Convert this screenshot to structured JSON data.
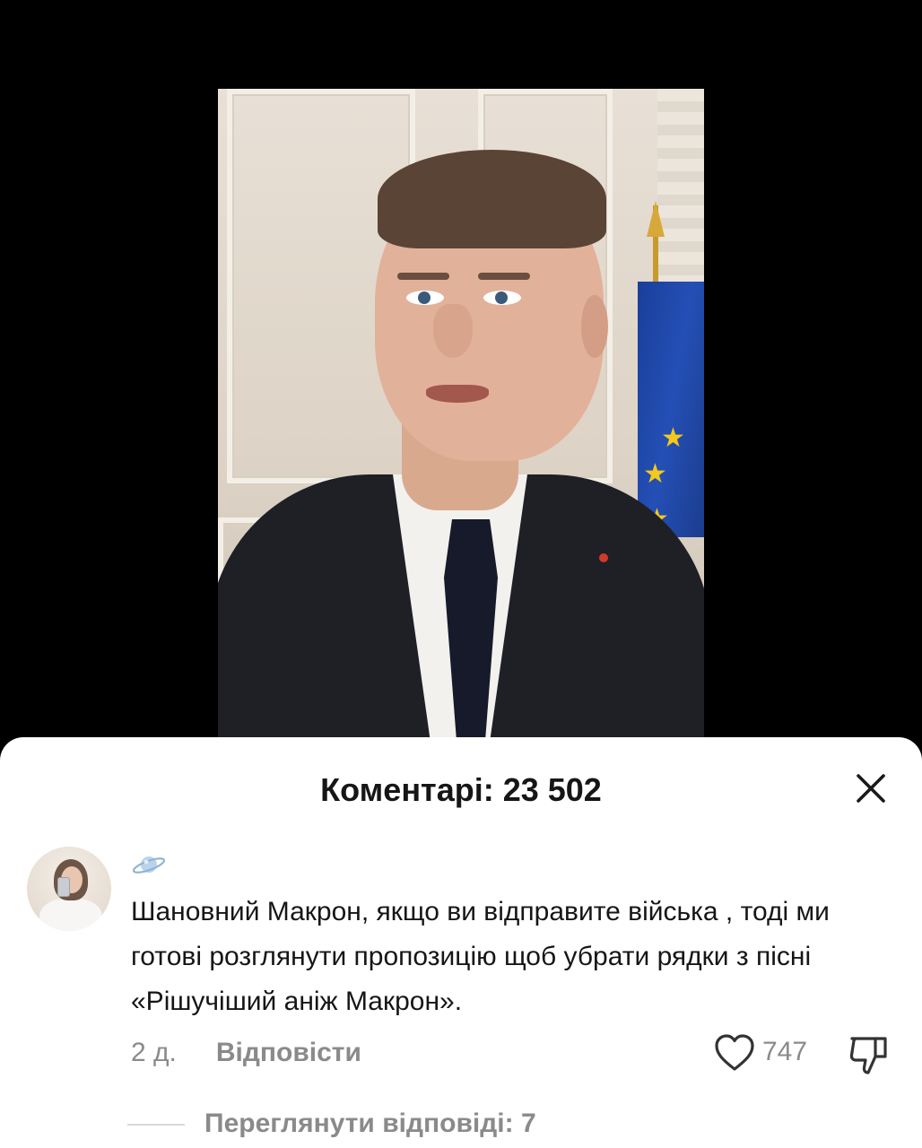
{
  "comments_sheet": {
    "title": "Коментарі: 23 502",
    "close_icon": "close-icon"
  },
  "comment": {
    "username_emoji": "ringed-planet-icon",
    "text": "Шановний Макрон, якщо ви відправите війська , тоді ми готові розглянути пропозицію щоб убрати рядки з пісні «Рішучіший аніж Макрон».",
    "time": "2 д.",
    "reply_label": "Відповісти",
    "like_icon": "heart-icon",
    "likes": "747",
    "dislike_icon": "thumbs-down-icon",
    "view_replies_label": "Переглянути відповіді: 7"
  }
}
